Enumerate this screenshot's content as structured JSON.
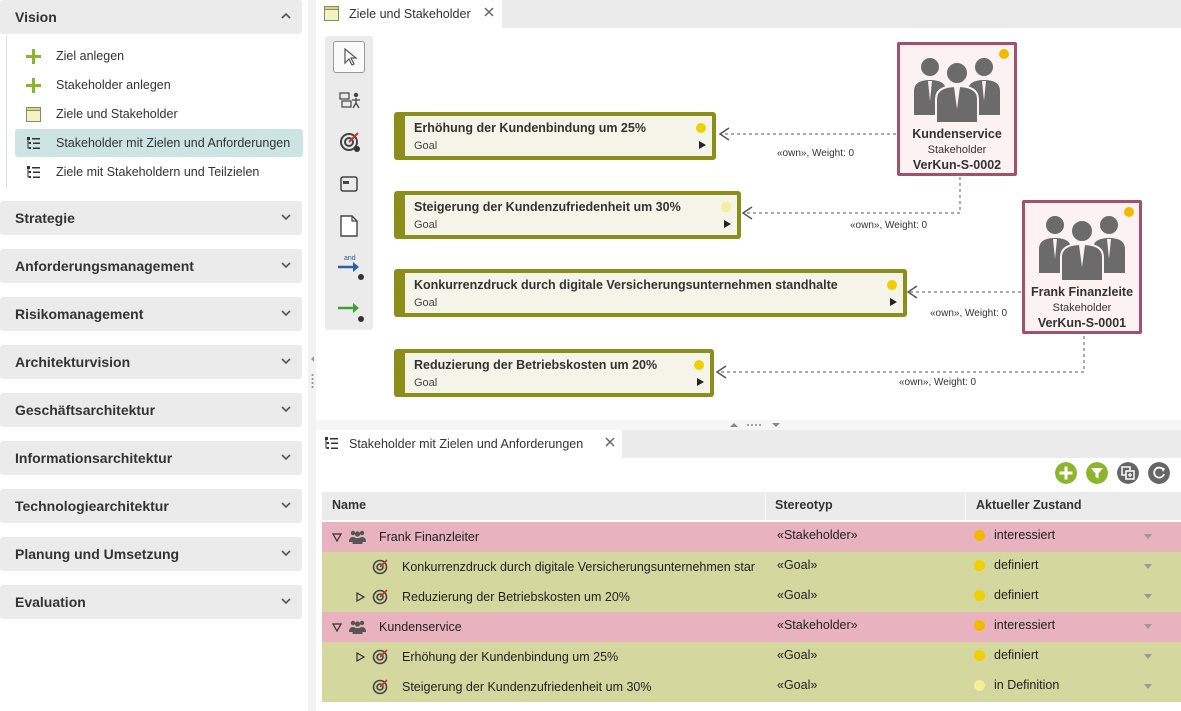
{
  "sidebar": {
    "vision": {
      "title": "Vision",
      "items": [
        {
          "label": "Ziel anlegen",
          "icon": "plus-icon"
        },
        {
          "label": "Stakeholder anlegen",
          "icon": "plus-icon"
        },
        {
          "label": "Ziele und Stakeholder",
          "icon": "diagram-icon"
        },
        {
          "label": "Stakeholder mit Zielen und Anforderungen",
          "icon": "tree-list-icon"
        },
        {
          "label": "Ziele mit Stakeholdern und Teilzielen",
          "icon": "tree-list-icon"
        }
      ]
    },
    "sections": [
      "Strategie",
      "Anforderungsmanagement",
      "Risikomanagement",
      "Architekturvision",
      "Geschäftsarchitektur",
      "Informationsarchitektur",
      "Technologiearchitektur",
      "Planung und Umsetzung",
      "Evaluation"
    ]
  },
  "diagram_tab": {
    "label": "Ziele und Stakeholder"
  },
  "diagram": {
    "goals": [
      {
        "name": "Erhöhung der Kundenbindung um 25%",
        "type": "Goal",
        "status_color": "#f0d000"
      },
      {
        "name": "Steigerung der Kundenzufriedenheit um 30%",
        "type": "Goal",
        "status_color": "#f5ee9a"
      },
      {
        "name": "Konkurrenzdruck durch digitale Versicherungsunternehmen standhalte",
        "type": "Goal",
        "status_color": "#f0d000"
      },
      {
        "name": "Reduzierung der Betriebskosten um 20%",
        "type": "Goal",
        "status_color": "#f0d000"
      }
    ],
    "stakeholders": [
      {
        "name": "Kundenservice",
        "stereotype": "Stakeholder",
        "id": "VerKun-S-0002",
        "status_color": "#f5b800"
      },
      {
        "name": "Frank Finanzleite",
        "stereotype": "Stakeholder",
        "id": "VerKun-S-0001",
        "status_color": "#f5b800"
      }
    ],
    "relation_label": "«own», Weight:  0"
  },
  "table_tab": {
    "label": "Stakeholder mit Zielen und Anforderungen"
  },
  "table": {
    "columns": [
      "Name",
      "Stereotyp",
      "Aktueller Zustand"
    ],
    "rows": [
      {
        "kind": "stakeholder",
        "expander": "expanded",
        "level": 0,
        "name": "Frank Finanzleiter",
        "stereotype": "«Stakeholder»",
        "state": "interessiert",
        "state_color": "#f5b800"
      },
      {
        "kind": "goal",
        "expander": "none",
        "level": 1,
        "name": "Konkurrenzdruck durch digitale Versicherungsunternehmen standhalten",
        "stereotype": "«Goal»",
        "state": "definiert",
        "state_color": "#f0d000"
      },
      {
        "kind": "goal",
        "expander": "collapsed",
        "level": 1,
        "name": "Reduzierung der Betriebskosten um 20%",
        "stereotype": "«Goal»",
        "state": "definiert",
        "state_color": "#f0d000"
      },
      {
        "kind": "stakeholder",
        "expander": "expanded",
        "level": 0,
        "name": "Kundenservice",
        "stereotype": "«Stakeholder»",
        "state": "interessiert",
        "state_color": "#f5b800"
      },
      {
        "kind": "goal",
        "expander": "collapsed",
        "level": 1,
        "name": "Erhöhung der Kundenbindung um 25%",
        "stereotype": "«Goal»",
        "state": "definiert",
        "state_color": "#f0d000"
      },
      {
        "kind": "goal",
        "expander": "none",
        "level": 1,
        "name": "Steigerung der Kundenzufriedenheit um 30%",
        "stereotype": "«Goal»",
        "state": "in Definition",
        "state_color": "#f5ee9a"
      }
    ]
  },
  "colors": {
    "goal_border": "#8b8f1a",
    "stakeholder_border": "#a3506c",
    "stakeholder_row": "#e8b3be",
    "goal_row": "#d4d89f",
    "active_sidebar": "#cde4e4",
    "accent_green": "#8cb42c"
  }
}
